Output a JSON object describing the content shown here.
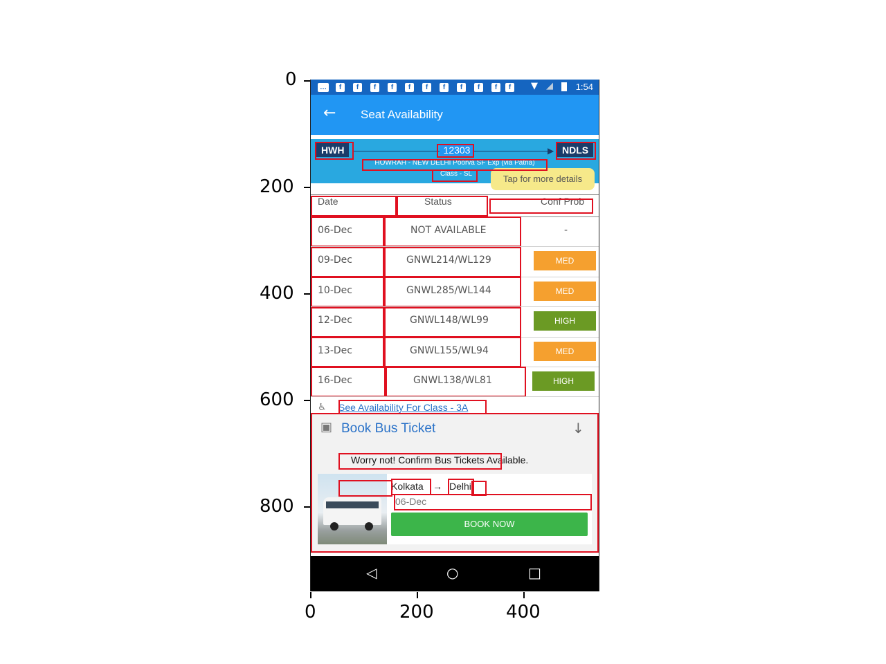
{
  "axes": {
    "y_ticks": [
      "0",
      "200",
      "400",
      "600",
      "800"
    ],
    "x_ticks": [
      "0",
      "200",
      "400"
    ]
  },
  "status_bar": {
    "icons": [
      "message-icon",
      "facebook-icon",
      "facebook-icon",
      "facebook-icon",
      "facebook-icon",
      "facebook-icon",
      "facebook-icon",
      "facebook-icon",
      "facebook-icon",
      "facebook-icon",
      "facebook-icon",
      "facebook-icon",
      "wifi-icon",
      "no-signal-icon",
      "battery-icon"
    ],
    "time": "1:54"
  },
  "app_bar": {
    "title": "Seat Availability"
  },
  "train": {
    "from": "HWH",
    "to": "NDLS",
    "number": "12303",
    "name": "HOWRAH - NEW DELHI Poorva SF Exp (via Patna)",
    "class": "Class - SL",
    "tooltip": "Tap for more details"
  },
  "table": {
    "headers": {
      "date": "Date",
      "status": "Status",
      "conf": "Conf Prob"
    },
    "rows": [
      {
        "date": "06-Dec",
        "status": "NOT AVAILABLE",
        "conf": "-"
      },
      {
        "date": "09-Dec",
        "status": "GNWL214/WL129",
        "conf": "MED"
      },
      {
        "date": "10-Dec",
        "status": "GNWL285/WL144",
        "conf": "MED"
      },
      {
        "date": "12-Dec",
        "status": "GNWL148/WL99",
        "conf": "HIGH"
      },
      {
        "date": "13-Dec",
        "status": "GNWL155/WL94",
        "conf": "MED"
      },
      {
        "date": "16-Dec",
        "status": "GNWL138/WL81",
        "conf": "HIGH"
      }
    ]
  },
  "colors": {
    "med": "#f5a02f",
    "high": "#6b9a24",
    "primary": "#2196f3"
  },
  "links": {
    "see_availability": "See Availability For Class - 3A"
  },
  "bus": {
    "title": "Book Bus Ticket",
    "message": "Worry not! Confirm Bus Tickets Available.",
    "from": "Kolkata",
    "separator": "→",
    "to": "Delhi",
    "date": "06-Dec",
    "book_label": "BOOK NOW"
  },
  "nav": {
    "back": "◁",
    "home": "○",
    "recents": "□"
  }
}
